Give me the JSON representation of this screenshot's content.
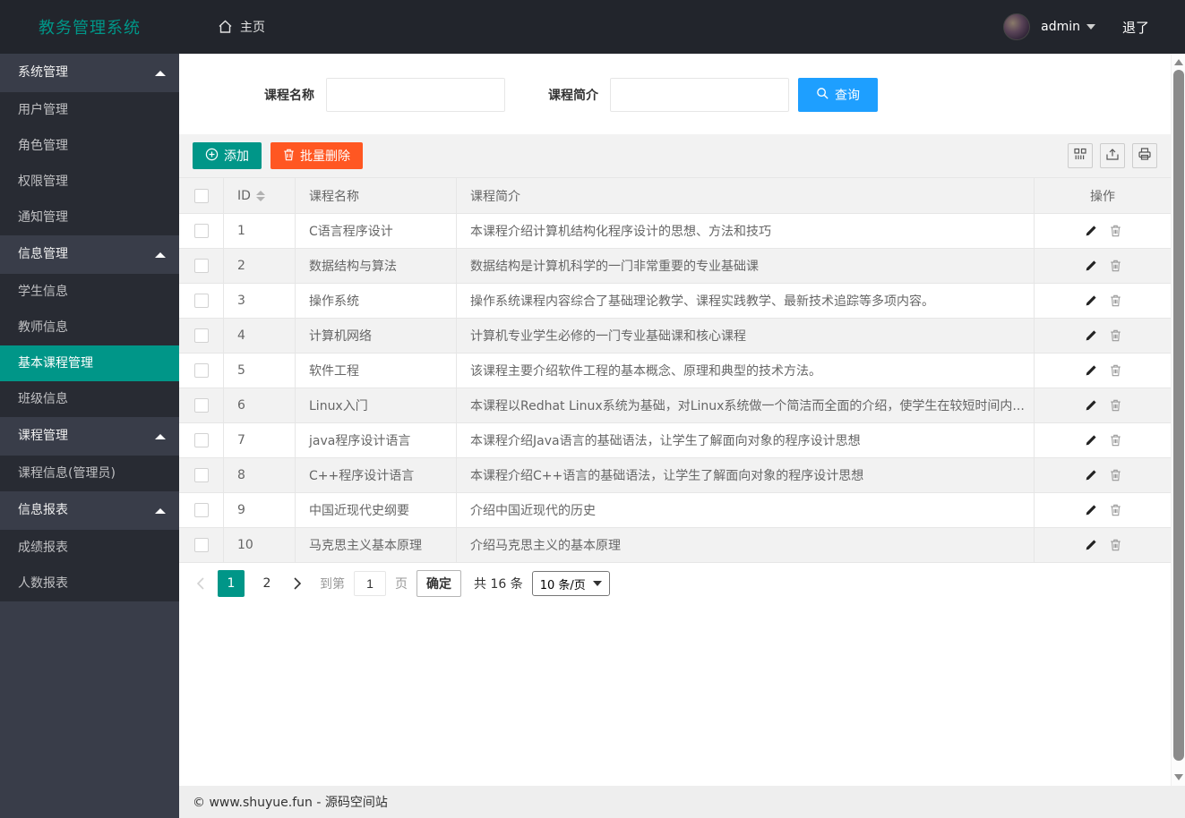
{
  "navbar": {
    "title": "教务管理系统",
    "home_label": "主页",
    "username": "admin",
    "logout_label": "退了"
  },
  "sidebar": {
    "active_item": "基本课程管理",
    "groups": [
      {
        "label": "系统管理",
        "items": [
          "用户管理",
          "角色管理",
          "权限管理",
          "通知管理"
        ]
      },
      {
        "label": "信息管理",
        "items": [
          "学生信息",
          "教师信息",
          "基本课程管理",
          "班级信息"
        ]
      },
      {
        "label": "课程管理",
        "items": [
          "课程信息(管理员)"
        ]
      },
      {
        "label": "信息报表",
        "items": [
          "成绩报表",
          "人数报表"
        ]
      }
    ]
  },
  "search": {
    "name_label": "课程名称",
    "name_value": "",
    "intro_label": "课程简介",
    "intro_value": "",
    "query_label": "查询"
  },
  "toolbar": {
    "add_label": "添加",
    "batch_delete_label": "批量删除"
  },
  "table": {
    "columns": [
      "ID",
      "课程名称",
      "课程简介",
      "操作"
    ],
    "rows": [
      {
        "id": "1",
        "name": "C语言程序设计",
        "intro": "本课程介绍计算机结构化程序设计的思想、方法和技巧"
      },
      {
        "id": "2",
        "name": "数据结构与算法",
        "intro": "数据结构是计算机科学的一门非常重要的专业基础课"
      },
      {
        "id": "3",
        "name": "操作系统",
        "intro": "操作系统课程内容综合了基础理论教学、课程实践教学、最新技术追踪等多项内容。"
      },
      {
        "id": "4",
        "name": "计算机网络",
        "intro": "计算机专业学生必修的一门专业基础课和核心课程"
      },
      {
        "id": "5",
        "name": "软件工程",
        "intro": "该课程主要介绍软件工程的基本概念、原理和典型的技术方法。"
      },
      {
        "id": "6",
        "name": "Linux入门",
        "intro": "本课程以Redhat Linux系统为基础，对Linux系统做一个简洁而全面的介绍，使学生在较短时间内..."
      },
      {
        "id": "7",
        "name": "java程序设计语言",
        "intro": "本课程介绍Java语言的基础语法，让学生了解面向对象的程序设计思想"
      },
      {
        "id": "8",
        "name": "C++程序设计语言",
        "intro": "本课程介绍C++语言的基础语法，让学生了解面向对象的程序设计思想"
      },
      {
        "id": "9",
        "name": "中国近现代史纲要",
        "intro": "介绍中国近现代的历史"
      },
      {
        "id": "10",
        "name": "马克思主义基本原理",
        "intro": "介绍马克思主义的基本原理"
      }
    ]
  },
  "pagination": {
    "pages": [
      "1",
      "2"
    ],
    "active_page": "1",
    "goto_label": "到第",
    "goto_value": "1",
    "page_unit": "页",
    "confirm_label": "确定",
    "total_text": "共 16 条",
    "page_size_value": "10 条/页"
  },
  "footer": {
    "copyright": "© www.shuyue.fun - 源码空间站"
  },
  "colors": {
    "accent_teal": "#009688",
    "danger_orange": "#FF5722",
    "primary_blue": "#1E9FFF",
    "navbar_bg": "#22252c",
    "sidebar_bg": "#393D49",
    "sidebar_item_bg": "#282B33"
  },
  "icons": {
    "home": "house-outline",
    "user_caret": "triangle-down",
    "group_collapse": "triangle-up",
    "query": "magnifier",
    "add": "circle-plus",
    "batch_delete": "trash",
    "cols": "grid-columns",
    "export": "export-tray",
    "print": "printer",
    "sort": "caret-up-down",
    "edit": "pencil",
    "delete": "trash-outline"
  }
}
